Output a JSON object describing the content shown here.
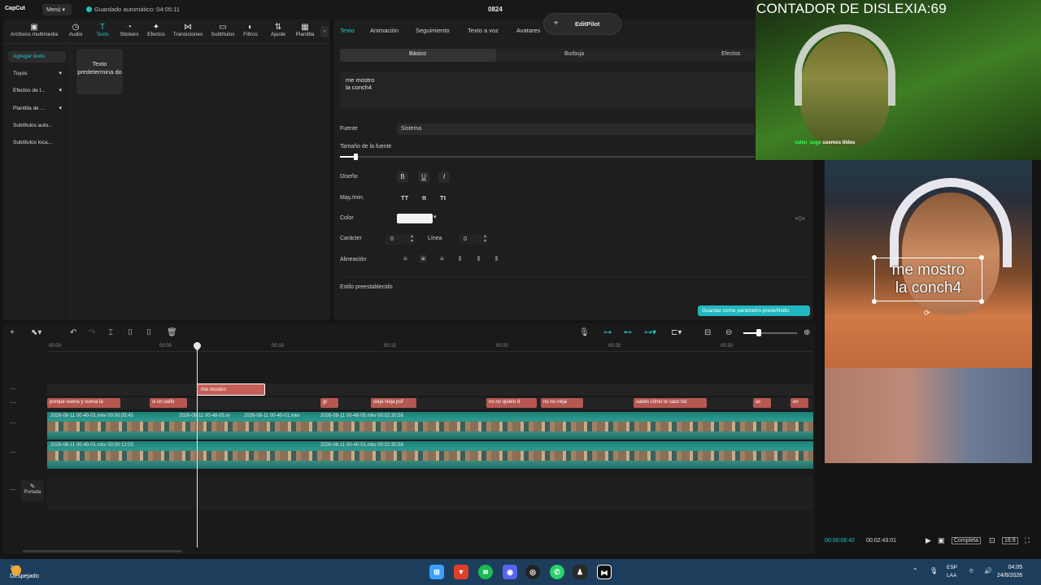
{
  "app": {
    "logo": "CapCut",
    "menu": "Menú ▾",
    "autosave": "Guardado automático: 04:05:11",
    "title": "0824"
  },
  "toolbar": [
    {
      "label": "Archivos multimedia",
      "icon": "▣"
    },
    {
      "label": "Audio",
      "icon": "◷"
    },
    {
      "label": "Texto",
      "icon": "T"
    },
    {
      "label": "Stickers",
      "icon": "◔"
    },
    {
      "label": "Efectos",
      "icon": "✦"
    },
    {
      "label": "Transiciones",
      "icon": "⋈"
    },
    {
      "label": "Subtítulos",
      "icon": "▭"
    },
    {
      "label": "Filtros",
      "icon": "◐"
    },
    {
      "label": "Ajuste",
      "icon": "⇅"
    },
    {
      "label": "Plantilla",
      "icon": "▦"
    }
  ],
  "sidebar": [
    {
      "label": "Agregar texto"
    },
    {
      "label": "Tuyos"
    },
    {
      "label": "Efectos de t..."
    },
    {
      "label": "Plantilla de ..."
    },
    {
      "label": "Subtítulos auto..."
    },
    {
      "label": "Subtítulos loca..."
    }
  ],
  "card": {
    "label": "Texto predetermina do"
  },
  "props": {
    "tabs": [
      "Texto",
      "Animación",
      "Seguimiento",
      "Texto a voz",
      "Avatares"
    ],
    "subtabs": [
      "Básico",
      "Burbuja",
      "Efectos"
    ],
    "text_line1": "me mostro",
    "text_line2": "la conch4",
    "font_label": "Fuente",
    "font_value": "Sistema",
    "size_label": "Tamaño de la fuente",
    "design_label": "Diseño",
    "case_label": "May./min.",
    "color_label": "Color",
    "char_label": "Carácter",
    "char_value": "0",
    "line_label": "Línea",
    "line_value": "0",
    "align_label": "Alineación",
    "preset_label": "Estilo preestablecido",
    "save_preset": "Guardar como parámetro predefinido",
    "design_buttons": [
      "B",
      "U",
      "I"
    ],
    "case_buttons": [
      "TT",
      "tt",
      "Tt"
    ]
  },
  "editpilot": "EditPilot",
  "webcam": {
    "counter": "CONTADOR DE DISLEXIA:69",
    "chat_user": "valen_auge",
    "chat_msg": "usemos tildes"
  },
  "preview": {
    "overlay_line1": "me mostro",
    "overlay_line2": "la conch4",
    "time_current": "00:00:06:42",
    "time_total": "00:02:43:01",
    "ratio": "Completa",
    "aspect": "16:9"
  },
  "timeline": {
    "ticks": [
      "00:00",
      "00:05",
      "00:10",
      "00:15",
      "00:20",
      "00:25",
      "00:30"
    ],
    "selected_clip": "me mostro",
    "text_clips": [
      "porque suena y suena la",
      "si un oaifo",
      "gr",
      "vieja vieja puf",
      "no no quiero d",
      "no no vieja",
      "sabés cómo te saco toc",
      "ac",
      "en"
    ],
    "track1_labels": [
      "2026-08-11 00-40-01.mkv  00:00:05:45",
      "2026-08-11 00-48-05.m",
      "2026-08-11 00-40-01.mkv",
      "2026-08-11 00-48-05.mkv  00:02:30:58"
    ],
    "track2_labels": [
      "2026-08-11 00-40-01.mkv  00:00:12:03",
      "2026-08-11 00-40-01.mkv  00:02:30:58"
    ],
    "cover": "Portada"
  },
  "taskbar": {
    "temp": "7°C",
    "weather": "Despejado",
    "lang1": "ESP",
    "lang2": "LAA",
    "time": "04:05",
    "date": "24/8/2026"
  }
}
